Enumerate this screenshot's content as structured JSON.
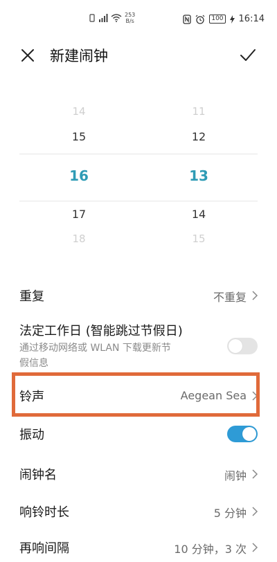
{
  "status_bar": {
    "net_speed_value": "253",
    "net_speed_unit": "B/s",
    "battery": "100",
    "time": "16:14"
  },
  "header": {
    "title": "新建闹钟"
  },
  "time_picker": {
    "hours": [
      "14",
      "15",
      "16",
      "17",
      "18"
    ],
    "minutes": [
      "11",
      "12",
      "13",
      "14",
      "15"
    ],
    "selected_hour": "16",
    "selected_minute": "13"
  },
  "settings": {
    "repeat": {
      "label": "重复",
      "value": "不重复"
    },
    "workday": {
      "label": "法定工作日 (智能跳过节假日)",
      "sub_line1": "通过移动网络或 WLAN 下载更新节",
      "sub_line2": "假信息",
      "enabled": false
    },
    "ringtone": {
      "label": "铃声",
      "value": "Aegean Sea"
    },
    "vibrate": {
      "label": "振动",
      "enabled": true
    },
    "alarm_name": {
      "label": "闹钟名",
      "value": "闹钟"
    },
    "ring_duration": {
      "label": "响铃时长",
      "value": "5 分钟"
    },
    "snooze": {
      "label": "再响间隔",
      "value": "10 分钟，3 次"
    }
  },
  "colors": {
    "accent": "#2e9bb5",
    "toggle_on": "#2e9bd6",
    "highlight": "#e06a3a"
  }
}
